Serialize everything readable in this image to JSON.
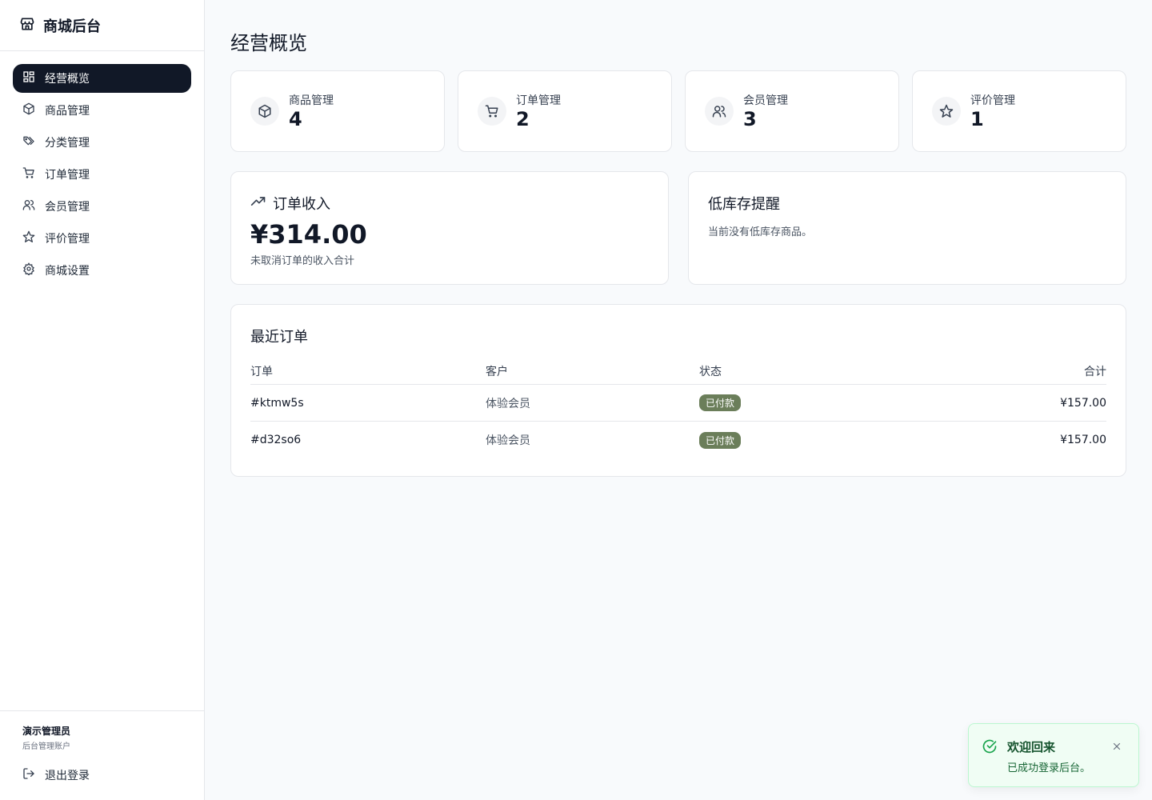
{
  "sidebar": {
    "brand": "商城后台",
    "items": [
      {
        "label": "经营概览",
        "icon": "dashboard-icon",
        "active": true
      },
      {
        "label": "商品管理",
        "icon": "package-icon"
      },
      {
        "label": "分类管理",
        "icon": "tags-icon"
      },
      {
        "label": "订单管理",
        "icon": "cart-icon"
      },
      {
        "label": "会员管理",
        "icon": "users-icon"
      },
      {
        "label": "评价管理",
        "icon": "star-icon"
      },
      {
        "label": "商城设置",
        "icon": "gear-icon"
      }
    ],
    "user": {
      "name": "演示管理员",
      "role": "后台管理账户"
    },
    "logout": "退出登录"
  },
  "main": {
    "title": "经营概览",
    "stats": [
      {
        "label": "商品管理",
        "value": "4",
        "icon": "package-icon"
      },
      {
        "label": "订单管理",
        "value": "2",
        "icon": "cart-icon"
      },
      {
        "label": "会员管理",
        "value": "3",
        "icon": "users-icon"
      },
      {
        "label": "评价管理",
        "value": "1",
        "icon": "star-icon"
      }
    ],
    "revenue": {
      "title": "订单收入",
      "value": "¥314.00",
      "sub": "未取消订单的收入合计"
    },
    "stock": {
      "title": "低库存提醒",
      "desc": "当前没有低库存商品。"
    },
    "orders": {
      "title": "最近订单",
      "headers": [
        "订单",
        "客户",
        "状态",
        "合计"
      ],
      "rows": [
        {
          "id": "#ktmw5s",
          "customer": "体验会员",
          "status": "已付款",
          "total": "¥157.00"
        },
        {
          "id": "#d32so6",
          "customer": "体验会员",
          "status": "已付款",
          "total": "¥157.00"
        }
      ]
    }
  },
  "toast": {
    "title": "欢迎回来",
    "message": "已成功登录后台。"
  },
  "colors": {
    "accent": "#111827",
    "badge": "#6b7e5a",
    "success": "#16a34a"
  }
}
